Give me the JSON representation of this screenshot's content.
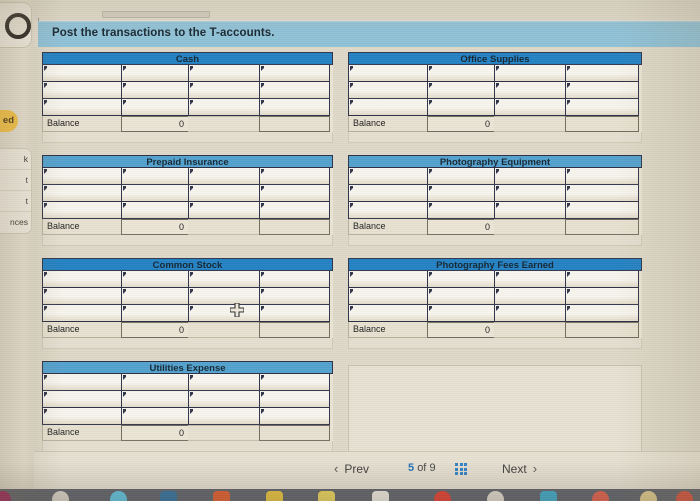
{
  "window": {
    "instruction": "Post the transactions to the T-accounts."
  },
  "left_sidebar": {
    "badge_label": "ed",
    "menu_items": [
      {
        "label": "k"
      },
      {
        "label": "t"
      },
      {
        "label": "t"
      },
      {
        "label": "nces"
      }
    ]
  },
  "accounts": {
    "balance_label": "Balance",
    "balance_value": "0",
    "left_column": [
      {
        "title": "Cash",
        "rows": 3
      },
      {
        "title": "Prepaid Insurance",
        "rows": 3
      },
      {
        "title": "Common Stock",
        "rows": 3
      },
      {
        "title": "Utilities Expense",
        "rows": 3
      }
    ],
    "right_column": [
      {
        "title": "Office Supplies",
        "rows": 3
      },
      {
        "title": "Photography Equipment",
        "rows": 3
      },
      {
        "title": "Photography Fees Earned",
        "rows": 3
      }
    ]
  },
  "pager": {
    "prev_label": "Prev",
    "next_label": "Next",
    "prev_chevron": "‹",
    "next_chevron": "›",
    "current_page": "5",
    "of_label": "of",
    "total_pages": "9",
    "grid_icon": "grid-icon"
  },
  "colors": {
    "title_blue": "#1e7fc2",
    "title_blue_pale": "#4f9fcd",
    "instruction_bar": "#8dc0d6",
    "sheet_bg": "#ddd7c7",
    "accent_link": "#1d6fb8",
    "badge_yellow": "#f5c344"
  }
}
